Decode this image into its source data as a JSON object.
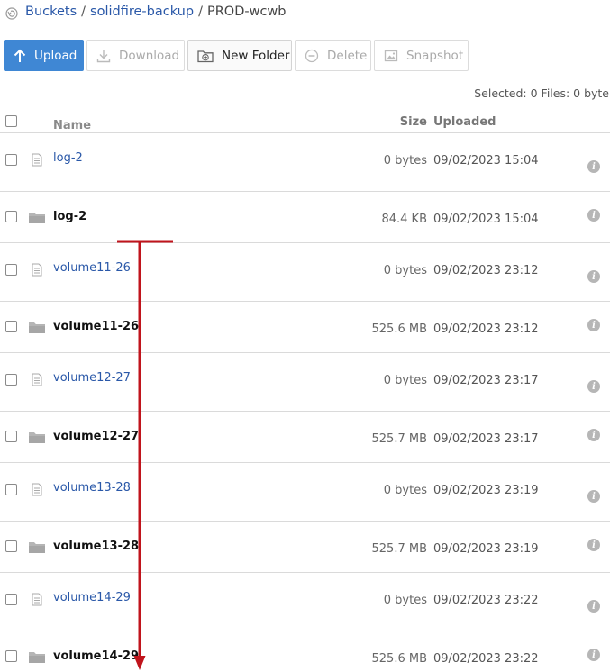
{
  "breadcrumb": {
    "icon": "back-circle-icon",
    "items": [
      "Buckets",
      "solidfire-backup"
    ],
    "separator": "/",
    "current": "PROD-wcwb"
  },
  "toolbar": {
    "upload": "Upload",
    "download": "Download",
    "new_folder": "New Folder",
    "delete": "Delete",
    "snapshot": "Snapshot"
  },
  "selected_info": "Selected: 0 Files: 0 byte",
  "columns": {
    "name": "Name",
    "size": "Size",
    "uploaded": "Uploaded"
  },
  "rows": [
    {
      "type": "file",
      "name": "log-2",
      "size": "0 bytes",
      "uploaded": "09/02/2023 15:04"
    },
    {
      "type": "folder",
      "name": "log-2",
      "size": "84.4 KB",
      "uploaded": "09/02/2023 15:04"
    },
    {
      "type": "file",
      "name": "volume11-26",
      "size": "0 bytes",
      "uploaded": "09/02/2023 23:12"
    },
    {
      "type": "folder",
      "name": "volume11-26",
      "size": "525.6 MB",
      "uploaded": "09/02/2023 23:12"
    },
    {
      "type": "file",
      "name": "volume12-27",
      "size": "0 bytes",
      "uploaded": "09/02/2023 23:17"
    },
    {
      "type": "folder",
      "name": "volume12-27",
      "size": "525.7 MB",
      "uploaded": "09/02/2023 23:17"
    },
    {
      "type": "file",
      "name": "volume13-28",
      "size": "0 bytes",
      "uploaded": "09/02/2023 23:19"
    },
    {
      "type": "folder",
      "name": "volume13-28",
      "size": "525.7 MB",
      "uploaded": "09/02/2023 23:19"
    },
    {
      "type": "file",
      "name": "volume14-29",
      "size": "0 bytes",
      "uploaded": "09/02/2023 23:22"
    },
    {
      "type": "folder",
      "name": "volume14-29",
      "size": "525.6 MB",
      "uploaded": "09/02/2023 23:22"
    }
  ],
  "info_glyph": "i",
  "colors": {
    "link": "#2a58a8",
    "primary_button": "#3f87d4",
    "annotation_arrow": "#c0141c",
    "info_icon": "#b6b6b6"
  }
}
